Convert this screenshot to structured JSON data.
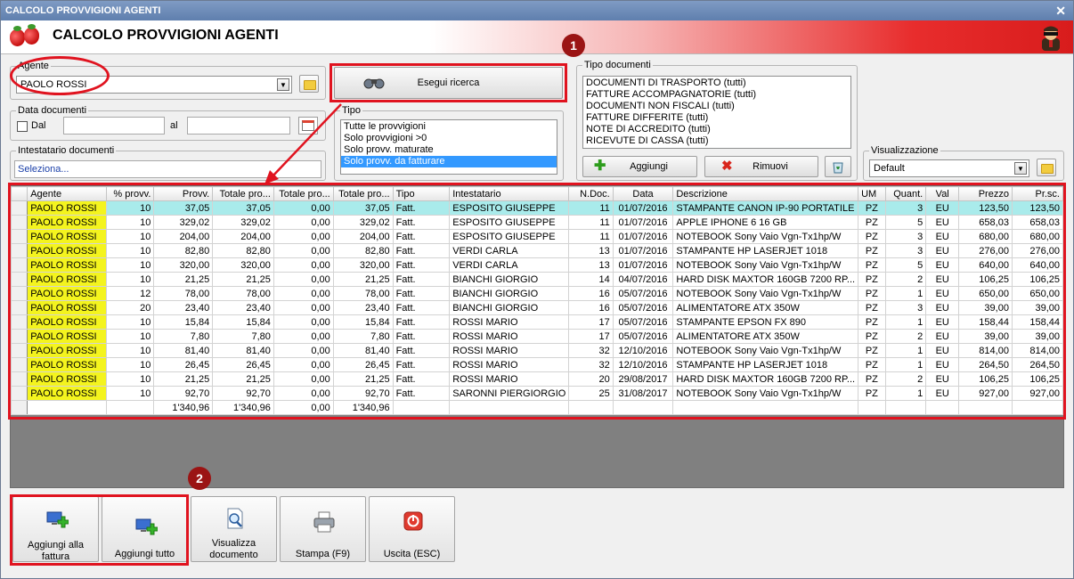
{
  "window": {
    "title": "CALCOLO PROVVIGIONI AGENTI",
    "close_label": "✕"
  },
  "header": {
    "title": "CALCOLO PROVVIGIONI AGENTI"
  },
  "agente": {
    "legend": "Agente",
    "value": "PAOLO ROSSI"
  },
  "data_documenti": {
    "legend": "Data documenti",
    "dal_label": "Dal",
    "al_label": "al",
    "dal_value": "",
    "al_value": ""
  },
  "intestatario": {
    "legend": "Intestatario documenti",
    "value": "Seleziona..."
  },
  "search": {
    "label": "Esegui ricerca"
  },
  "tipo": {
    "legend": "Tipo",
    "options": [
      "Tutte le provvigioni",
      "Solo provvigioni >0",
      "Solo provv. maturate",
      "Solo provv. da fatturare"
    ],
    "selected_index": 3
  },
  "tipo_documenti": {
    "legend": "Tipo documenti",
    "items": [
      "DOCUMENTI DI TRASPORTO (tutti)",
      "FATTURE ACCOMPAGNATORIE (tutti)",
      "DOCUMENTI NON FISCALI (tutti)",
      "FATTURE DIFFERITE (tutti)",
      "NOTE DI ACCREDITO (tutti)",
      "RICEVUTE DI CASSA (tutti)"
    ],
    "add_label": "Aggiungi",
    "remove_label": "Rimuovi"
  },
  "visualizzazione": {
    "legend": "Visualizzazione",
    "value": "Default"
  },
  "badges": {
    "one": "1",
    "two": "2"
  },
  "grid": {
    "columns": [
      "Agente",
      "% provv.",
      "Provv.",
      "Totale pro...",
      "Totale pro...",
      "Totale pro...",
      "Tipo",
      "Intestatario",
      "N.Doc.",
      "Data",
      "Descrizione",
      "UM",
      "Quant.",
      "Val",
      "Prezzo",
      "Pr.sc."
    ],
    "rows": [
      [
        "PAOLO ROSSI",
        "10",
        "37,05",
        "37,05",
        "0,00",
        "37,05",
        "Fatt.",
        "ESPOSITO GIUSEPPE",
        "11",
        "01/07/2016",
        "STAMPANTE CANON IP-90 PORTATILE",
        "PZ",
        "3",
        "EU",
        "123,50",
        "123,50"
      ],
      [
        "PAOLO ROSSI",
        "10",
        "329,02",
        "329,02",
        "0,00",
        "329,02",
        "Fatt.",
        "ESPOSITO GIUSEPPE",
        "11",
        "01/07/2016",
        "APPLE IPHONE 6 16 GB",
        "PZ",
        "5",
        "EU",
        "658,03",
        "658,03"
      ],
      [
        "PAOLO ROSSI",
        "10",
        "204,00",
        "204,00",
        "0,00",
        "204,00",
        "Fatt.",
        "ESPOSITO GIUSEPPE",
        "11",
        "01/07/2016",
        "NOTEBOOK Sony Vaio Vgn-Tx1hp/W",
        "PZ",
        "3",
        "EU",
        "680,00",
        "680,00"
      ],
      [
        "PAOLO ROSSI",
        "10",
        "82,80",
        "82,80",
        "0,00",
        "82,80",
        "Fatt.",
        "VERDI CARLA",
        "13",
        "01/07/2016",
        "STAMPANTE HP LASERJET 1018",
        "PZ",
        "3",
        "EU",
        "276,00",
        "276,00"
      ],
      [
        "PAOLO ROSSI",
        "10",
        "320,00",
        "320,00",
        "0,00",
        "320,00",
        "Fatt.",
        "VERDI CARLA",
        "13",
        "01/07/2016",
        "NOTEBOOK Sony Vaio Vgn-Tx1hp/W",
        "PZ",
        "5",
        "EU",
        "640,00",
        "640,00"
      ],
      [
        "PAOLO ROSSI",
        "10",
        "21,25",
        "21,25",
        "0,00",
        "21,25",
        "Fatt.",
        "BIANCHI GIORGIO",
        "14",
        "04/07/2016",
        "HARD DISK MAXTOR 160GB 7200 RP...",
        "PZ",
        "2",
        "EU",
        "106,25",
        "106,25"
      ],
      [
        "PAOLO ROSSI",
        "12",
        "78,00",
        "78,00",
        "0,00",
        "78,00",
        "Fatt.",
        "BIANCHI GIORGIO",
        "16",
        "05/07/2016",
        "NOTEBOOK Sony Vaio Vgn-Tx1hp/W",
        "PZ",
        "1",
        "EU",
        "650,00",
        "650,00"
      ],
      [
        "PAOLO ROSSI",
        "20",
        "23,40",
        "23,40",
        "0,00",
        "23,40",
        "Fatt.",
        "BIANCHI GIORGIO",
        "16",
        "05/07/2016",
        "ALIMENTATORE ATX 350W",
        "PZ",
        "3",
        "EU",
        "39,00",
        "39,00"
      ],
      [
        "PAOLO ROSSI",
        "10",
        "15,84",
        "15,84",
        "0,00",
        "15,84",
        "Fatt.",
        "ROSSI MARIO",
        "17",
        "05/07/2016",
        "STAMPANTE EPSON FX 890",
        "PZ",
        "1",
        "EU",
        "158,44",
        "158,44"
      ],
      [
        "PAOLO ROSSI",
        "10",
        "7,80",
        "7,80",
        "0,00",
        "7,80",
        "Fatt.",
        "ROSSI MARIO",
        "17",
        "05/07/2016",
        "ALIMENTATORE ATX 350W",
        "PZ",
        "2",
        "EU",
        "39,00",
        "39,00"
      ],
      [
        "PAOLO ROSSI",
        "10",
        "81,40",
        "81,40",
        "0,00",
        "81,40",
        "Fatt.",
        "ROSSI MARIO",
        "32",
        "12/10/2016",
        "NOTEBOOK Sony Vaio Vgn-Tx1hp/W",
        "PZ",
        "1",
        "EU",
        "814,00",
        "814,00"
      ],
      [
        "PAOLO ROSSI",
        "10",
        "26,45",
        "26,45",
        "0,00",
        "26,45",
        "Fatt.",
        "ROSSI MARIO",
        "32",
        "12/10/2016",
        "STAMPANTE HP LASERJET 1018",
        "PZ",
        "1",
        "EU",
        "264,50",
        "264,50"
      ],
      [
        "PAOLO ROSSI",
        "10",
        "21,25",
        "21,25",
        "0,00",
        "21,25",
        "Fatt.",
        "ROSSI MARIO",
        "20",
        "29/08/2017",
        "HARD DISK MAXTOR 160GB 7200 RP...",
        "PZ",
        "2",
        "EU",
        "106,25",
        "106,25"
      ],
      [
        "PAOLO ROSSI",
        "10",
        "92,70",
        "92,70",
        "0,00",
        "92,70",
        "Fatt.",
        "SARONNI PIERGIORGIO",
        "25",
        "31/08/2017",
        "NOTEBOOK Sony Vaio Vgn-Tx1hp/W",
        "PZ",
        "1",
        "EU",
        "927,00",
        "927,00"
      ]
    ],
    "totals": [
      "",
      "",
      "1'340,96",
      "1'340,96",
      "0,00",
      "1'340,96",
      "",
      "",
      "",
      "",
      "",
      "",
      "",
      "",
      "",
      ""
    ]
  },
  "toolbar": {
    "add_invoice": "Aggiungi alla fattura",
    "add_all": "Aggiungi tutto",
    "view_doc": "Visualizza documento",
    "print": "Stampa (F9)",
    "exit": "Uscita (ESC)"
  },
  "colors": {
    "accent_red": "#e0131f",
    "agent_cell": "#f4f41e",
    "selected_row": "#a9ebeb",
    "selection_blue": "#3399ff"
  }
}
